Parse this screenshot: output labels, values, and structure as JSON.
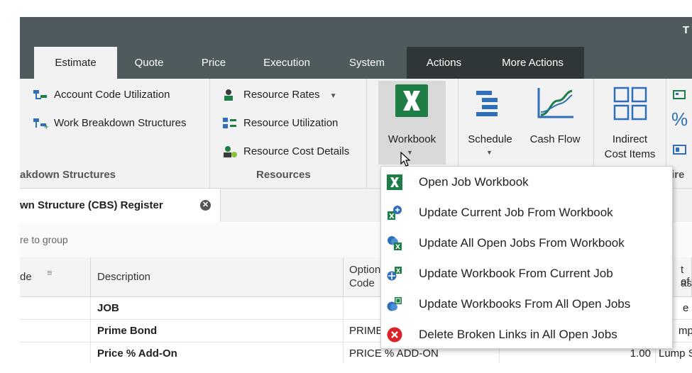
{
  "window": {
    "title_fragment": "T"
  },
  "tabs": [
    {
      "label": "Estimate",
      "active": true
    },
    {
      "label": "Quote"
    },
    {
      "label": "Price"
    },
    {
      "label": "Execution"
    },
    {
      "label": "System"
    },
    {
      "label": "Actions"
    },
    {
      "label": "More Actions"
    }
  ],
  "ribbon": {
    "breakdown": {
      "items": [
        "Account Code Utilization",
        "Work Breakdown Structures"
      ],
      "group_label": "akdown Structures"
    },
    "resources": {
      "items": [
        "Resource Rates",
        "Resource Utilization",
        "Resource Cost Details"
      ],
      "group_label": "Resources"
    },
    "workbook_label": "Workbook",
    "schedule_label": "Schedule",
    "cashflow_label": "Cash Flow",
    "indirect_label_1": "Indirect",
    "indirect_label_2": "Cost Items",
    "cut_group_label": "ire",
    "cut_icon_percent": "%"
  },
  "document_tab": {
    "label": "wn Structure (CBS) Register"
  },
  "group_hint": "re to group",
  "grid": {
    "headers": {
      "code": "de",
      "description": "Description",
      "option_code_1": "Option",
      "option_code_2": "Code",
      "unit_1": "t of",
      "unit_2": "asu"
    },
    "rows": [
      {
        "description": "JOB",
        "option_code": "",
        "qty": "",
        "unit": "e"
      },
      {
        "description": "Prime Bond",
        "option_code": "PRIME",
        "qty": "",
        "unit": "mp S"
      },
      {
        "description": "Price % Add-On",
        "option_code": "PRICE % ADD-ON",
        "qty": "1.00",
        "unit": "Lump S"
      }
    ]
  },
  "workbook_menu": {
    "items": [
      {
        "label": "Open Job Workbook",
        "icon": "excel-icon"
      },
      {
        "label": "Update Current Job From Workbook",
        "icon": "update-current-job-icon"
      },
      {
        "label": "Update All Open Jobs From Workbook",
        "icon": "update-all-jobs-icon"
      },
      {
        "label": "Update Workbook From Current Job",
        "icon": "update-workbook-icon"
      },
      {
        "label": "Update Workbooks From All Open Jobs",
        "icon": "update-workbooks-icon"
      },
      {
        "label": "Delete Broken Links in All Open Jobs",
        "icon": "delete-links-icon"
      }
    ]
  },
  "colors": {
    "titlebar": "#4e5a5e",
    "excel_green": "#1e7e45",
    "accent_blue": "#2e6fb7",
    "delete_red": "#d8232a"
  }
}
